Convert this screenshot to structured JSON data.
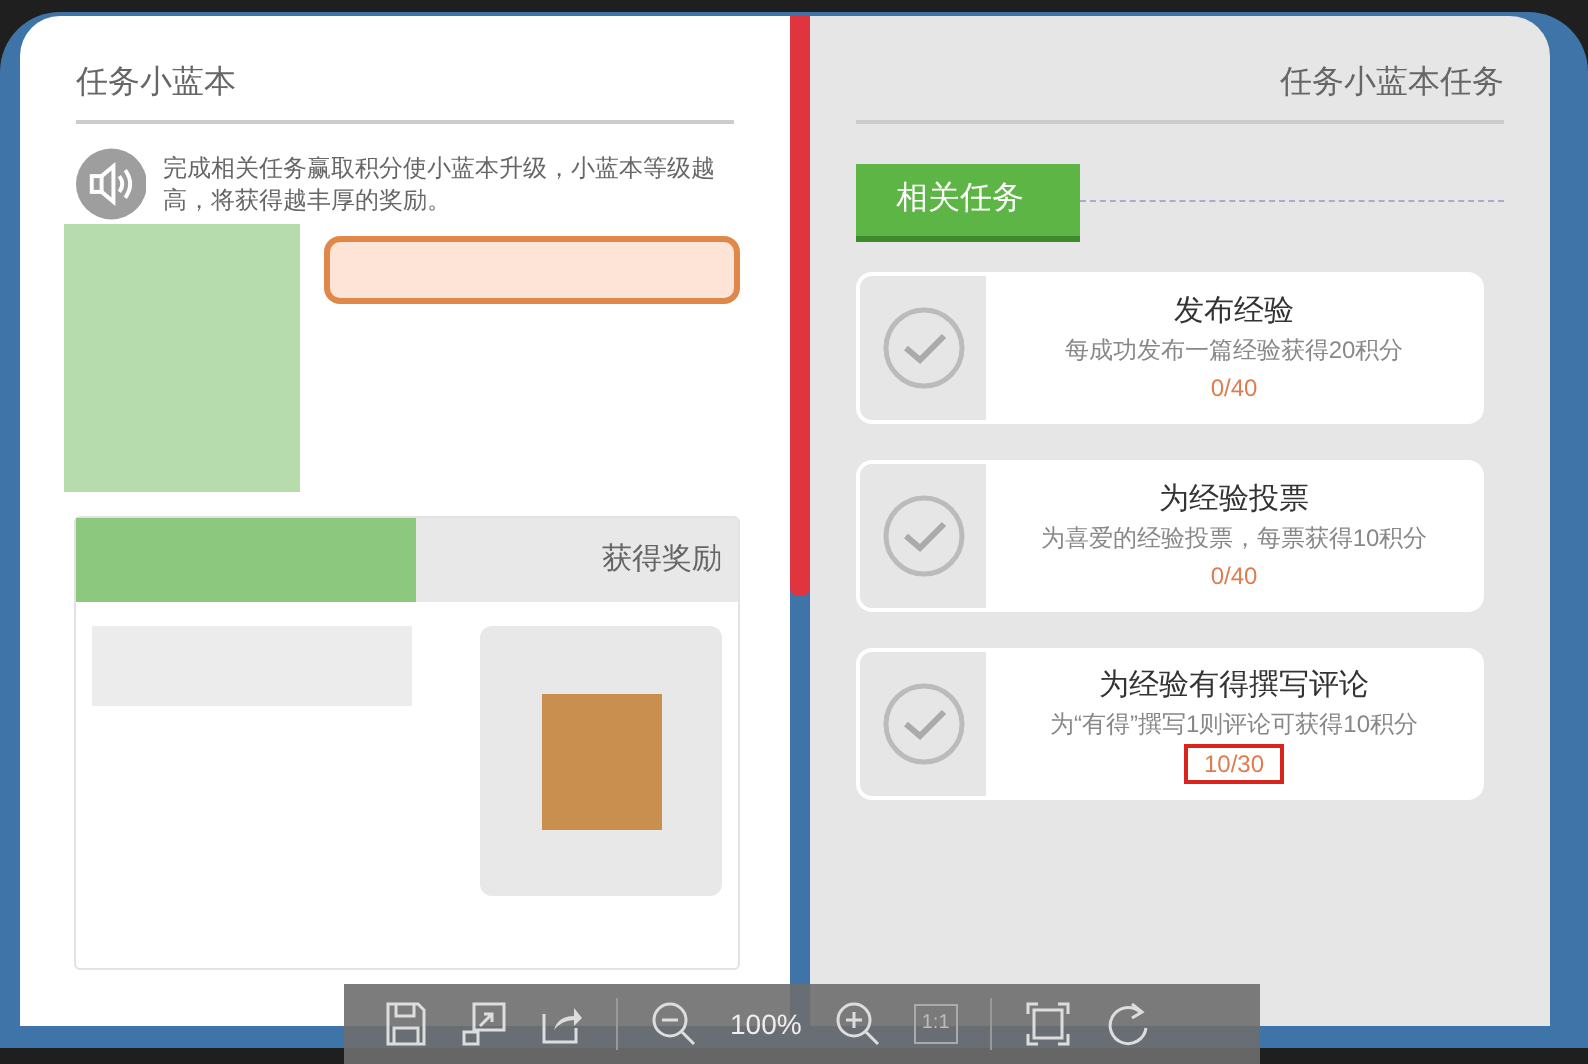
{
  "left_page": {
    "title": "任务小蓝本",
    "notice": "完成相关任务赢取积分使小蓝本升级，小蓝本等级越高，将获得越丰厚的奖励。",
    "reward_heading": "获得奖励"
  },
  "right_page": {
    "title": "任务小蓝本任务",
    "section_tab": "相关任务",
    "tasks": [
      {
        "title": "发布经验",
        "description": "每成功发布一篇经验获得20积分",
        "progress": "0/40",
        "highlighted": false
      },
      {
        "title": "为经验投票",
        "description": "为喜爱的经验投票，每票获得10积分",
        "progress": "0/40",
        "highlighted": false
      },
      {
        "title": "为经验有得撰写评论",
        "description": "为“有得”撰写1则评论可获得10积分",
        "progress": "10/30",
        "highlighted": true
      }
    ]
  },
  "toolbar": {
    "zoom": "100%",
    "actual_size": "1:1"
  }
}
